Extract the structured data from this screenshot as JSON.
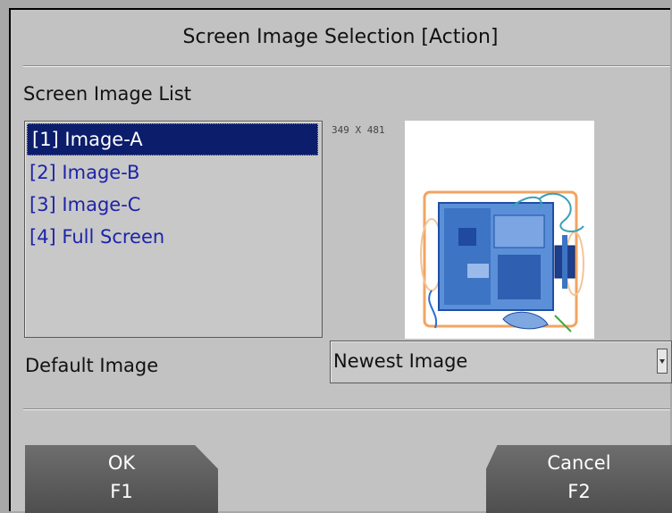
{
  "dialog": {
    "title": "Screen Image Selection [Action]",
    "list_label": "Screen Image List",
    "items": [
      {
        "label": "[1] Image-A",
        "selected": true
      },
      {
        "label": "[2] Image-B",
        "selected": false
      },
      {
        "label": "[3] Image-C",
        "selected": false
      },
      {
        "label": "[4] Full Screen",
        "selected": false
      }
    ],
    "preview_dimensions": "349 X 481",
    "default_label": "Default Image",
    "default_value": "Newest Image",
    "ok": {
      "label": "OK",
      "key": "F1"
    },
    "cancel": {
      "label": "Cancel",
      "key": "F2"
    }
  },
  "colors": {
    "selection": "#0b1d6b",
    "item_text": "#1d24a8",
    "button": "#5e5e5e",
    "xray_blue": "#2a6fd0",
    "xray_orange": "#f2a463",
    "xray_green": "#3aa83a"
  }
}
